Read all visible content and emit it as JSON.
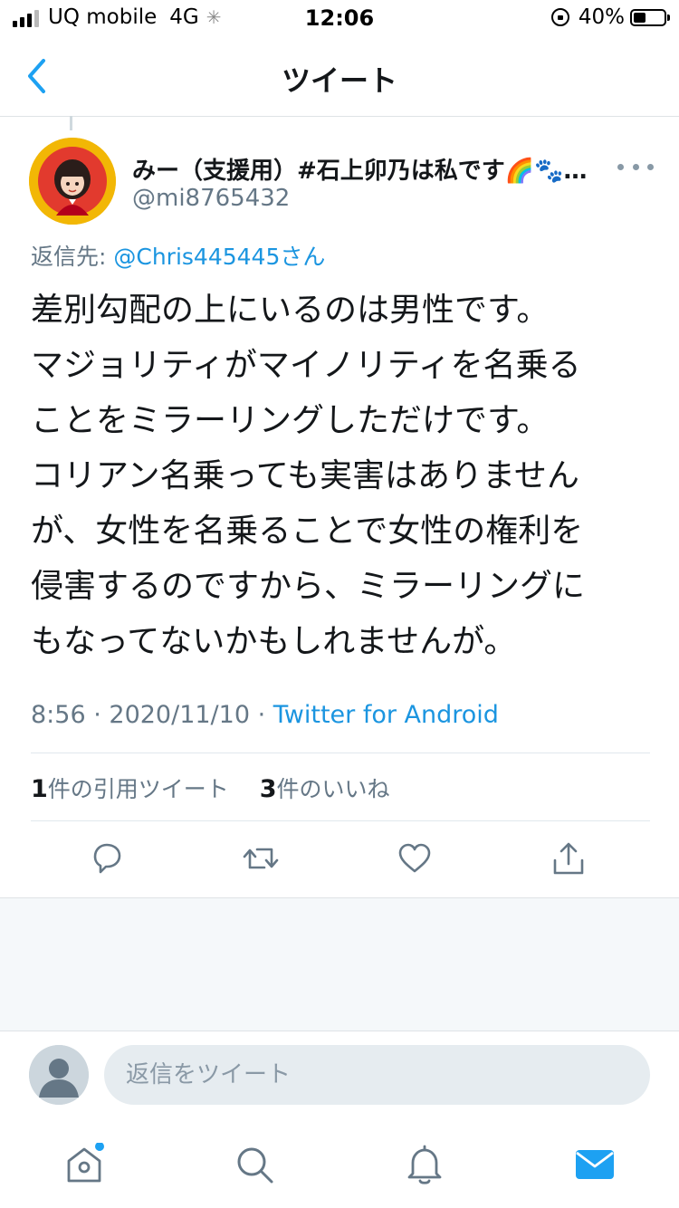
{
  "status_bar": {
    "carrier": "UQ mobile",
    "network": "4G",
    "time": "12:06",
    "battery": "40%"
  },
  "nav": {
    "title": "ツイート",
    "back_icon": "chevron-left-icon"
  },
  "tweet": {
    "author_name": "みー（支援用）#石上卯乃は私です🌈🐾…",
    "author_handle": "@mi8765432",
    "reply_prefix": "返信先: ",
    "reply_to": "@Chris445445さん",
    "text_lines": [
      "差別勾配の上にいるのは男性です。",
      "マジョリティがマイノリティを名乗る",
      "ことをミラーリングしただけです。",
      "コリアン名乗っても実害はありません",
      "が、女性を名乗ることで女性の権利を",
      "侵害するのですから、ミラーリングに",
      "もなってないかもしれませんが。"
    ],
    "time": "8:56",
    "date": "2020/11/10",
    "source": "Twitter for Android",
    "quote_count": "1",
    "quote_label": "件の引用ツイート",
    "like_count": "3",
    "like_label": "件のいいね"
  },
  "actions": [
    "reply-icon",
    "retweet-icon",
    "like-icon",
    "share-icon"
  ],
  "reply_box": {
    "placeholder": "返信をツイート"
  },
  "tab_bar": [
    "home-icon",
    "search-icon",
    "notifications-icon",
    "messages-icon"
  ],
  "colors": {
    "accent": "#1da1f2",
    "secondary_text": "#657786",
    "icon": "#657786"
  }
}
